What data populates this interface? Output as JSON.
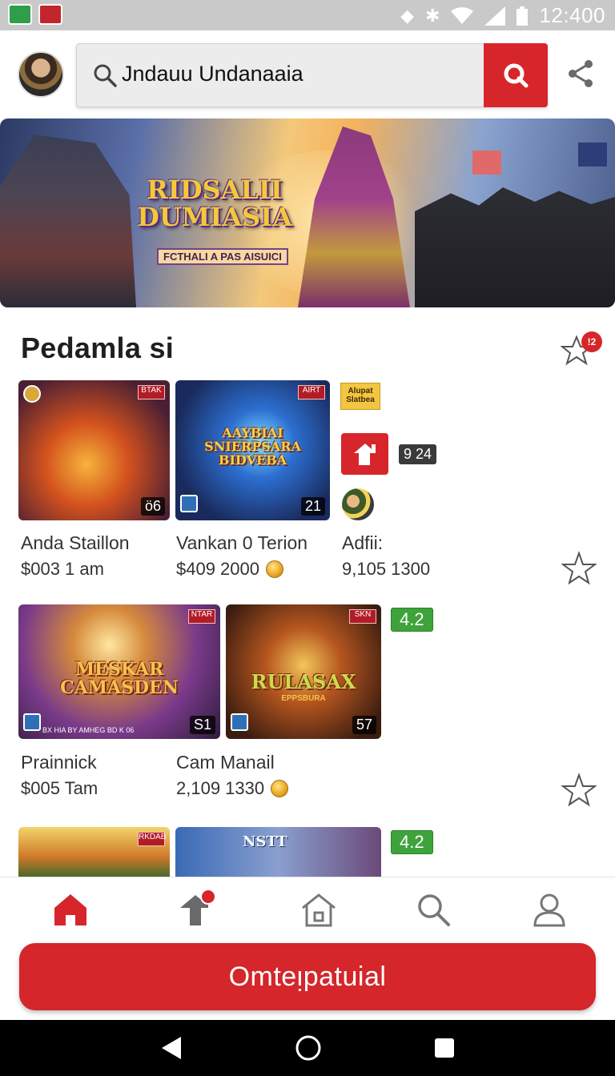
{
  "status_bar": {
    "time": "12:400",
    "icons": [
      "app-notification-icon",
      "media-notification-icon",
      "bluetooth-icon",
      "vibrate-icon",
      "wifi-icon",
      "signal-icon",
      "battery-icon"
    ]
  },
  "header": {
    "search_text": "Jndauu Undanaaia"
  },
  "banner": {
    "title": "RIDSALII DUMIASIA",
    "subtitle": "FCTHALI A PAS AISUICI"
  },
  "section": {
    "title": "Pedamla si",
    "notification_badge": "!2"
  },
  "row1": {
    "cards": [
      {
        "title": "Anda Staillon",
        "price": "$003 1 am",
        "badge": "ö6",
        "corner": "BTAK"
      },
      {
        "title": "Vankan 0 Terion",
        "price": "$409 2000",
        "badge": "21",
        "thumb_text": "AAYBIAI SNIERPSARA BIDVEBA",
        "corner": "AIRT"
      }
    ],
    "side": {
      "tag": "Alupat Slatbea",
      "count": "9 24",
      "title": "Adfii:",
      "price": "9,105 1300"
    }
  },
  "row2": {
    "cards": [
      {
        "title": "Prainnick",
        "price": "$005 Tam",
        "badge": "S1",
        "thumb_text": "MESKAR CAMASDEN",
        "footer": "BX HIA BY AMHEG BD K 06",
        "corner": "NTAR"
      },
      {
        "title": "Cam Manail",
        "price": "2,109 1330",
        "badge": "57",
        "thumb_text": "RULASAX",
        "sub": "EPPSBURA",
        "corner": "SKN"
      }
    ],
    "rating": "4.2"
  },
  "row3": {
    "thumb_text": "NSTT",
    "corner": "RKDAB",
    "rating": "4.2"
  },
  "bottom_nav": {
    "items": [
      "home",
      "store",
      "house",
      "search",
      "profile"
    ]
  },
  "cta": {
    "label": "Omteᴉpatuial"
  },
  "colors": {
    "accent": "#d7262b",
    "rating_green": "#3ea33a"
  }
}
